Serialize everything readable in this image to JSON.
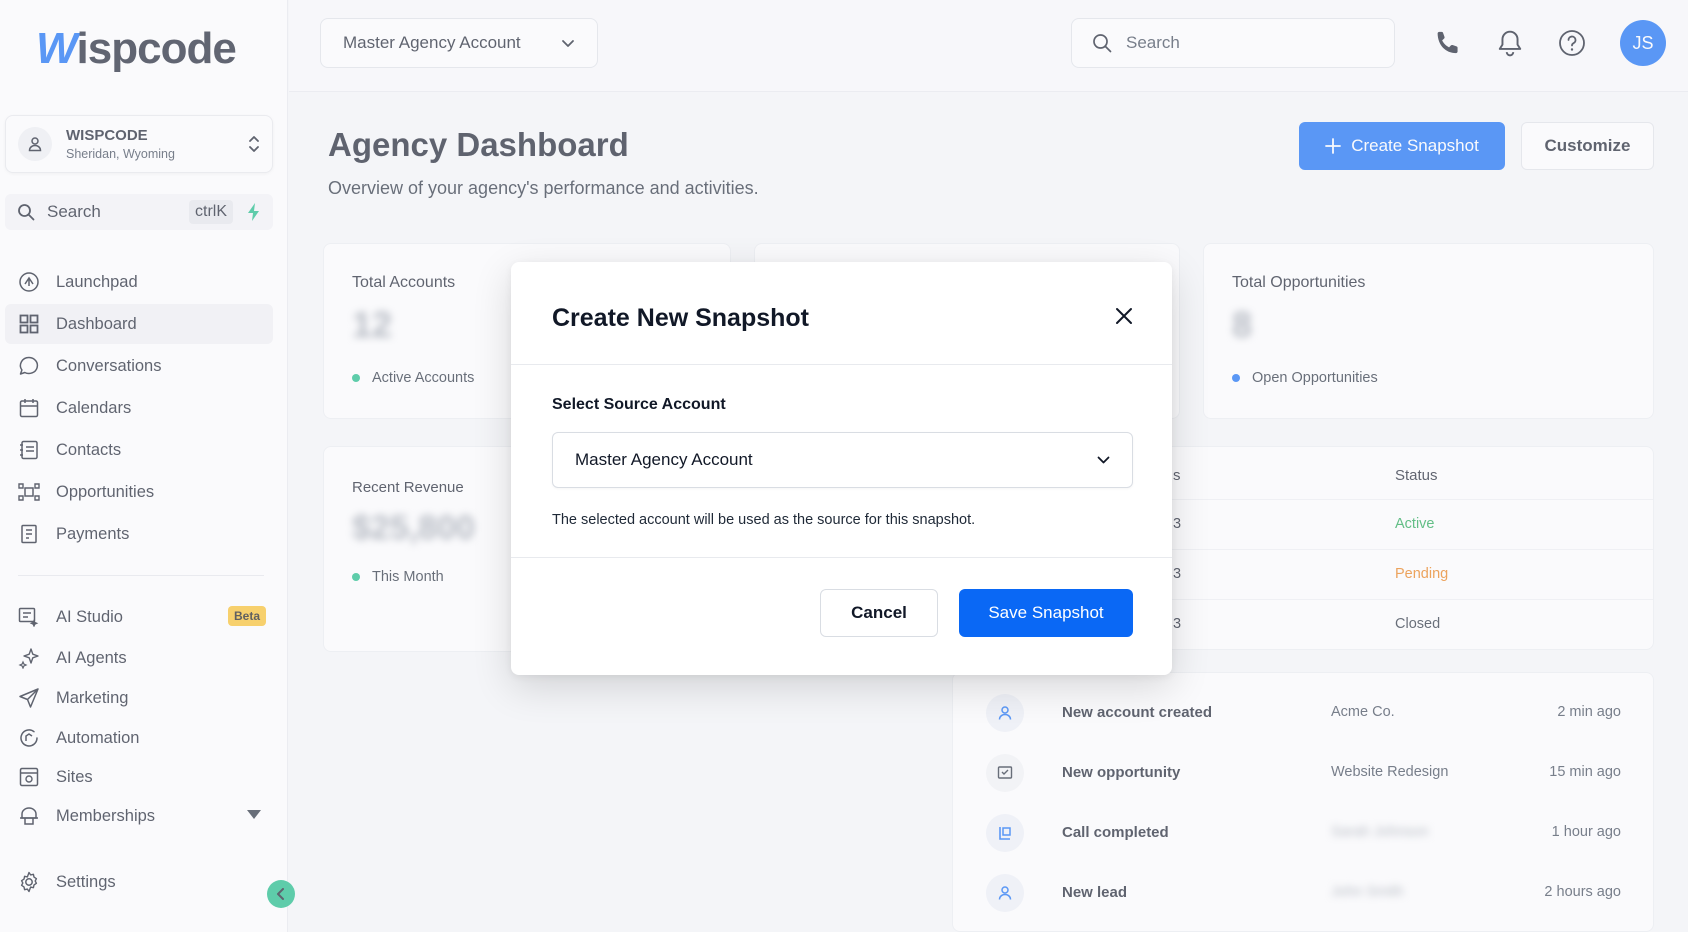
{
  "brand": {
    "logo_w": "W",
    "logo_rest": "ispcode"
  },
  "sidebar": {
    "account": {
      "name": "WISPCODE",
      "location": "Sheridan, Wyoming"
    },
    "search": {
      "label": "Search",
      "shortcut": "ctrlK"
    },
    "items": [
      {
        "label": "Launchpad",
        "icon": "launchpad-icon"
      },
      {
        "label": "Dashboard",
        "icon": "dashboard-grid-icon",
        "active": true
      },
      {
        "label": "Conversations",
        "icon": "chat-bubble-icon"
      },
      {
        "label": "Calendars",
        "icon": "calendar-icon"
      },
      {
        "label": "Contacts",
        "icon": "contacts-icon"
      },
      {
        "label": "Opportunities",
        "icon": "opportunities-icon"
      },
      {
        "label": "Payments",
        "icon": "payments-icon"
      },
      {
        "label": "AI Studio",
        "icon": "ai-studio-icon",
        "badge": "Beta"
      },
      {
        "label": "AI Agents",
        "icon": "sparkle-icon"
      },
      {
        "label": "Marketing",
        "icon": "send-icon"
      },
      {
        "label": "Automation",
        "icon": "automation-icon"
      },
      {
        "label": "Sites",
        "icon": "sites-icon"
      },
      {
        "label": "Memberships",
        "icon": "memberships-icon"
      },
      {
        "label": "Settings",
        "icon": "gear-icon"
      }
    ]
  },
  "topbar": {
    "account_select": "Master Agency Account",
    "search_placeholder": "Search",
    "user_initials": "JS"
  },
  "main": {
    "title": "Agency Dashboard",
    "subtitle": "Overview of your agency's performance and activities.",
    "create_snapshot_label": "Create Snapshot",
    "customize_label": "Customize",
    "cards": {
      "total_accounts": {
        "title": "Total Accounts",
        "value": "12",
        "foot": "Active Accounts"
      },
      "total_opportunities": {
        "title": "Total Opportunities",
        "value": "8",
        "foot": "Open Opportunities"
      },
      "recent_revenue": {
        "title": "Recent Revenue",
        "value": "$25,800",
        "foot": "This Month"
      }
    },
    "table": {
      "col_partial": "s",
      "col_status": "Status",
      "rows": [
        {
          "partial": "3",
          "status": "Active"
        },
        {
          "partial": "3",
          "status": "Pending"
        },
        {
          "partial": "3",
          "status": "Closed"
        }
      ]
    },
    "activity": [
      {
        "title": "New account created",
        "who": "Acme Co.",
        "time": "2 min ago"
      },
      {
        "title": "New opportunity",
        "who": "Website Redesign",
        "time": "15 min ago"
      },
      {
        "title": "Call completed",
        "who": "Sarah Johnson",
        "time": "1 hour ago"
      },
      {
        "title": "New lead",
        "who": "John Smith",
        "time": "2 hours ago"
      }
    ]
  },
  "modal": {
    "title": "Create New Snapshot",
    "field_label": "Select Source Account",
    "selected_value": "Master Agency Account",
    "help_text": "The selected account will be used as the source for this snapshot.",
    "cancel_label": "Cancel",
    "save_label": "Save Snapshot"
  },
  "colors": {
    "primary": "#0a68f5",
    "active": "#16a34a",
    "pending": "#ea7a0c",
    "accent_green": "#10b981",
    "beta": "#fbbf24"
  }
}
